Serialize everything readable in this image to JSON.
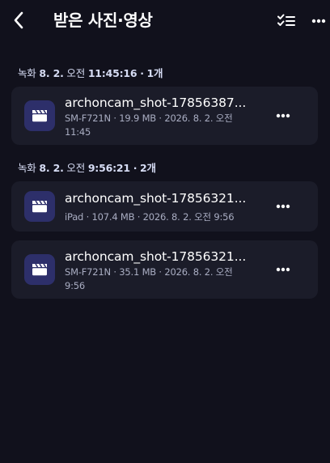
{
  "header": {
    "title": "받은 사진·영상",
    "back_icon": "chevron-left-icon",
    "select_icon": "checklist-icon",
    "more_icon": "more-dots-icon"
  },
  "groups": [
    {
      "label_prefix": "녹화",
      "date": "8. 2.",
      "ampm": "오전",
      "time": "11:45:16",
      "separator": "·",
      "count": "1개",
      "items": [
        {
          "name": "archoncam_shot-17856387...",
          "meta": "SM-F721N · 19.9 MB · 2026. 8. 2. 오전 11:45"
        }
      ]
    },
    {
      "label_prefix": "녹화",
      "date": "8. 2.",
      "ampm": "오전",
      "time": "9:56:21",
      "separator": "·",
      "count": "2개",
      "items": [
        {
          "name": "archoncam_shot-17856321...",
          "meta": "iPad · 107.4 MB · 2026. 8. 2. 오전 9:56"
        },
        {
          "name": "archoncam_shot-17856321...",
          "meta": "SM-F721N · 35.1 MB · 2026. 8. 2. 오전 9:56"
        }
      ]
    }
  ],
  "colors": {
    "background": "#11111c",
    "card": "#1b1c29",
    "thumb": "#2d2f6a",
    "accent_text": "#d6dcf4",
    "meta_text": "#a9adc2"
  }
}
